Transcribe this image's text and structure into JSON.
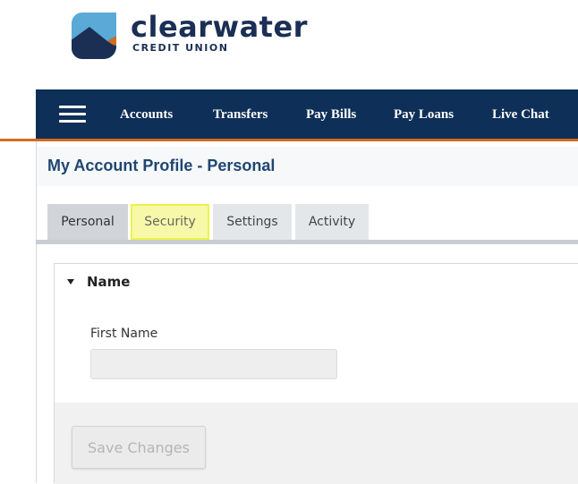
{
  "brand": {
    "name": "clearwater",
    "subtitle": "CREDIT UNION",
    "colors": {
      "navy": "#1b2f55",
      "orange": "#d36b1f",
      "sky": "#5aa9d6"
    }
  },
  "nav": {
    "items": [
      "Accounts",
      "Transfers",
      "Pay Bills",
      "Pay Loans",
      "Live Chat"
    ],
    "background": "#0e2f57",
    "accent": "#d36b1f"
  },
  "page": {
    "title": "My Account Profile - Personal"
  },
  "tabs": [
    {
      "label": "Personal",
      "active": true
    },
    {
      "label": "Security",
      "highlighted": true
    },
    {
      "label": "Settings"
    },
    {
      "label": "Activity"
    }
  ],
  "section": {
    "title": "Name",
    "expanded": true,
    "fields": [
      {
        "label": "First Name",
        "value": "",
        "disabled": true
      }
    ]
  },
  "actions": {
    "save_label": "Save Changes",
    "save_enabled": false
  }
}
